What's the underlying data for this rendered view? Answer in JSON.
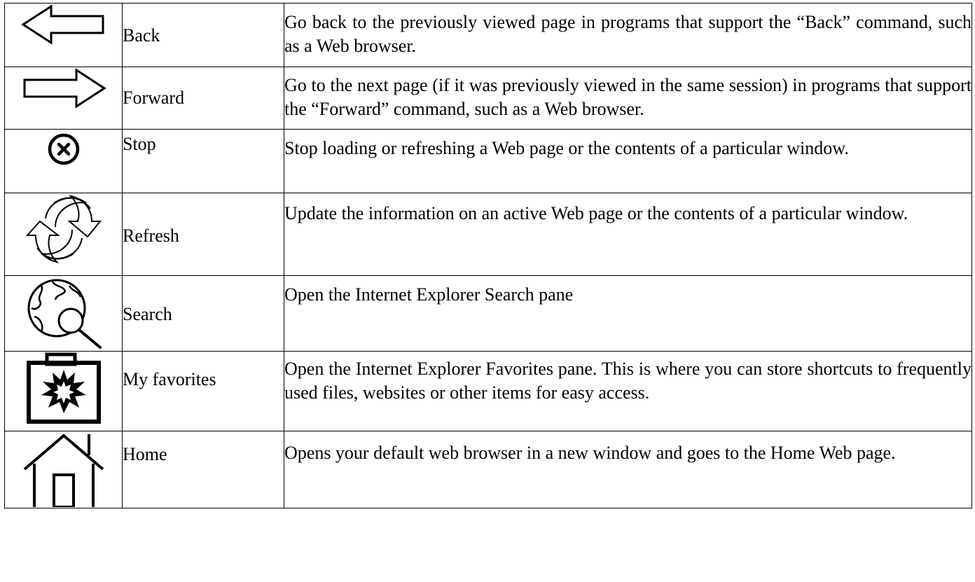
{
  "rows": [
    {
      "icon": "back-arrow-icon",
      "name": "Back",
      "description": "Go back to the previously viewed page in programs that support the “Back” command, such as a Web browser."
    },
    {
      "icon": "forward-arrow-icon",
      "name": "Forward",
      "description": "Go to the next page (if it was previously viewed in the same session) in programs that support the “Forward” command, such as a Web browser."
    },
    {
      "icon": "stop-icon",
      "name": "Stop",
      "description": "Stop loading or refreshing a Web page or the contents of a particular window."
    },
    {
      "icon": "refresh-icon",
      "name": "Refresh",
      "description": "Update the information on an active Web page or the contents of a particular window."
    },
    {
      "icon": "globe-search-icon",
      "name": "Search",
      "description": "Open the Internet Explorer Search pane"
    },
    {
      "icon": "favorites-folder-icon",
      "name": "My favorites",
      "description": "Open the Internet Explorer Favorites pane. This is where you can store shortcuts to frequently used files, websites or other items for easy access."
    },
    {
      "icon": "home-icon",
      "name": "Home",
      "description": "Opens your default web browser in a new window and goes to the Home Web page."
    }
  ]
}
